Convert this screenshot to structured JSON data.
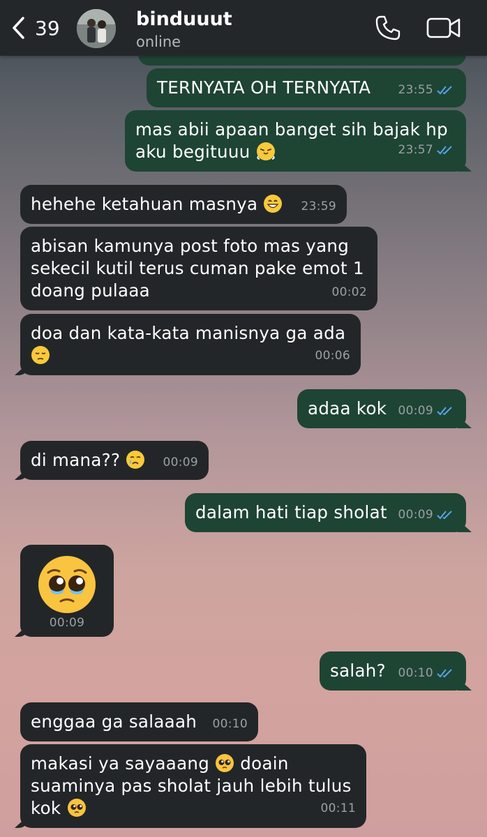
{
  "header": {
    "back_count": "39",
    "contact_name": "binduuut",
    "contact_status": "online"
  },
  "messages": [
    {
      "dir": "out",
      "text": "TERNYATA OH TERNYATA",
      "time": "23:55"
    },
    {
      "dir": "out",
      "text": "mas abii apaan banget sih bajak hp aku begituuu",
      "emoji": "huffing-face",
      "time": "23:57"
    },
    {
      "dir": "in",
      "text": "hehehe ketahuan masnya",
      "emoji": "grinning-face",
      "time": "23:59"
    },
    {
      "dir": "in",
      "text": "abisan kamunya post foto mas yang sekecil kutil terus cuman pake emot 1 doang pulaaa",
      "time": "00:02"
    },
    {
      "dir": "in",
      "text": "doa dan kata-kata manisnya ga ada",
      "emoji": "pensive-face",
      "time": "00:06"
    },
    {
      "dir": "out",
      "text": "adaa kok",
      "time": "00:09"
    },
    {
      "dir": "in",
      "text": "di mana??",
      "emoji": "crying-face",
      "time": "00:09"
    },
    {
      "dir": "out",
      "text": "dalam hati tiap sholat",
      "time": "00:09"
    },
    {
      "dir": "in",
      "text": "",
      "emoji": "pleading-face",
      "time": "00:09"
    },
    {
      "dir": "out",
      "text": "salah?",
      "time": "00:10"
    },
    {
      "dir": "in",
      "text": "enggaa ga salaaah",
      "time": "00:10"
    },
    {
      "dir": "in",
      "text_parts": [
        "makasi ya sayaaang",
        "doain suaminya pas sholat jauh lebih tulus kok"
      ],
      "emoji": "pleading-face",
      "time": "00:11"
    }
  ],
  "colors": {
    "header_bg": "#24272a",
    "incoming_bubble": "#232628",
    "outgoing_bubble": "#1e4434",
    "read_ticks": "#53a5ea",
    "timestamp": "#9ba0a3"
  }
}
